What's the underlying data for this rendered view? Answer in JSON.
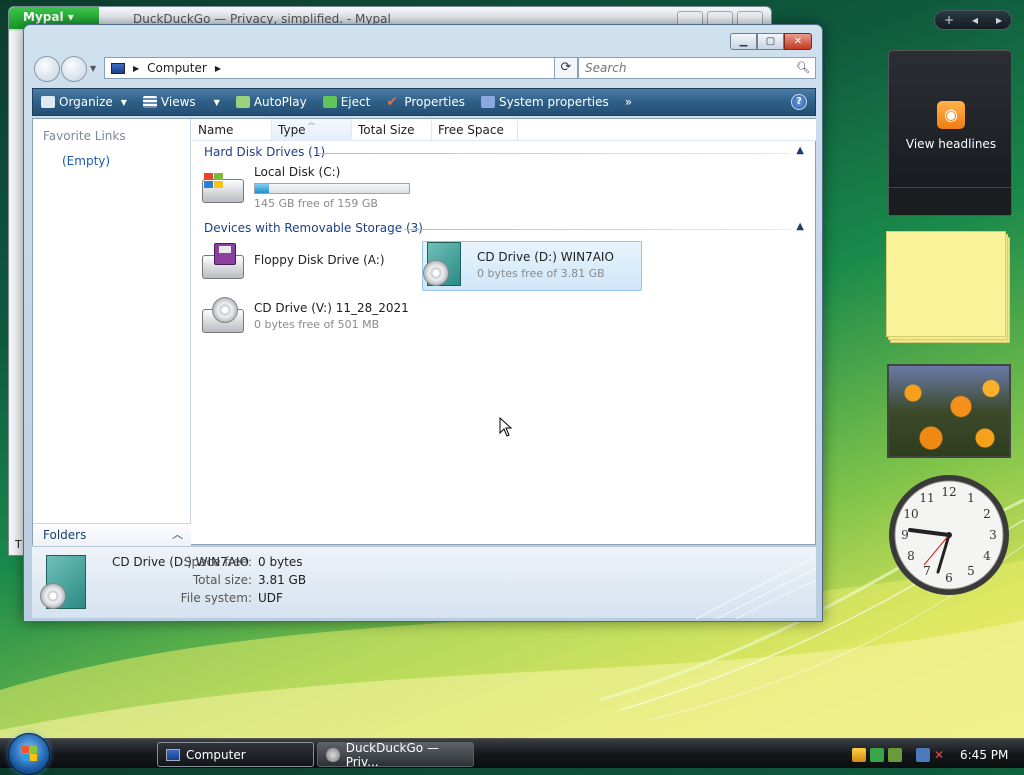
{
  "background_window": {
    "app_button": "Mypal",
    "title": "DuckDuckGo — Privacy, simplified. - Mypal",
    "left_strip_text": "T"
  },
  "explorer": {
    "address": {
      "location": "Computer"
    },
    "search": {
      "placeholder": "Search"
    },
    "toolbar": {
      "organize": "Organize",
      "views": "Views",
      "autoplay": "AutoPlay",
      "eject": "Eject",
      "properties": "Properties",
      "system_properties": "System properties",
      "more": "»",
      "help": "?"
    },
    "nav_pane": {
      "favorites_title": "Favorite Links",
      "empty": "(Empty)",
      "folders": "Folders"
    },
    "columns": [
      "Name",
      "Type",
      "Total Size",
      "Free Space"
    ],
    "groups": {
      "hdd": "Hard Disk Drives (1)",
      "removable": "Devices with Removable Storage (3)"
    },
    "drives": {
      "c": {
        "label": "Local Disk (C:)",
        "sub": "145 GB free of 159 GB",
        "used_fraction": 0.088
      },
      "a": {
        "label": "Floppy Disk Drive (A:)"
      },
      "d": {
        "label": "CD Drive (D:) WIN7AIO",
        "sub": "0 bytes free of 3.81 GB"
      },
      "v": {
        "label": "CD Drive (V:) 11_28_2021",
        "sub": "0 bytes free of 501 MB"
      }
    },
    "details": {
      "name": "CD Drive (D:) WIN7AIO",
      "space_free_label": "Space free:",
      "space_free": "0 bytes",
      "total_size_label": "Total size:",
      "total_size": "3.81 GB",
      "file_system_label": "File system:",
      "file_system": "UDF"
    }
  },
  "sidebar": {
    "add": "+",
    "feed_label": "View headlines"
  },
  "taskbar": {
    "computer": "Computer",
    "browser": "DuckDuckGo — Priv...",
    "time": "6:45 PM"
  },
  "colors": {
    "toolbar": "#2e5f87",
    "group_header": "#1c3f8a",
    "usage_fill": "#1e8fc8"
  }
}
